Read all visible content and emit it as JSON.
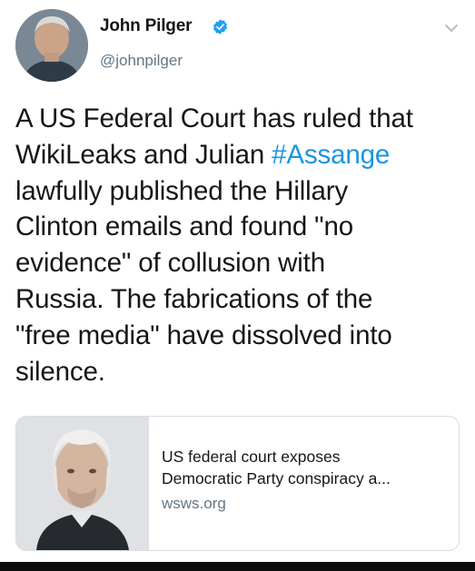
{
  "tweet": {
    "author_name": "John Pilger",
    "author_handle": "@johnpilger",
    "verified": true,
    "text_before_hashtag": "A US Federal Court has ruled that\nWikiLeaks and Julian ",
    "hashtag": "#Assange",
    "text_after_hashtag": "\nlawfully published the Hillary\nClinton emails and found \"no\nevidence\" of collusion with\nRussia. The fabrications of the\n\"free media\" have dissolved into\nsilence."
  },
  "card": {
    "title_line1": "US federal court exposes",
    "title_line2": "Democratic Party conspiracy a...",
    "domain": "wsws.org"
  },
  "icons": {
    "verified": "verified-badge-icon",
    "menu": "chevron-down-icon"
  },
  "colors": {
    "hashtag": "#1b95e0",
    "verified": "#1da1f2",
    "secondary_text": "#657786",
    "text": "#14171a"
  }
}
